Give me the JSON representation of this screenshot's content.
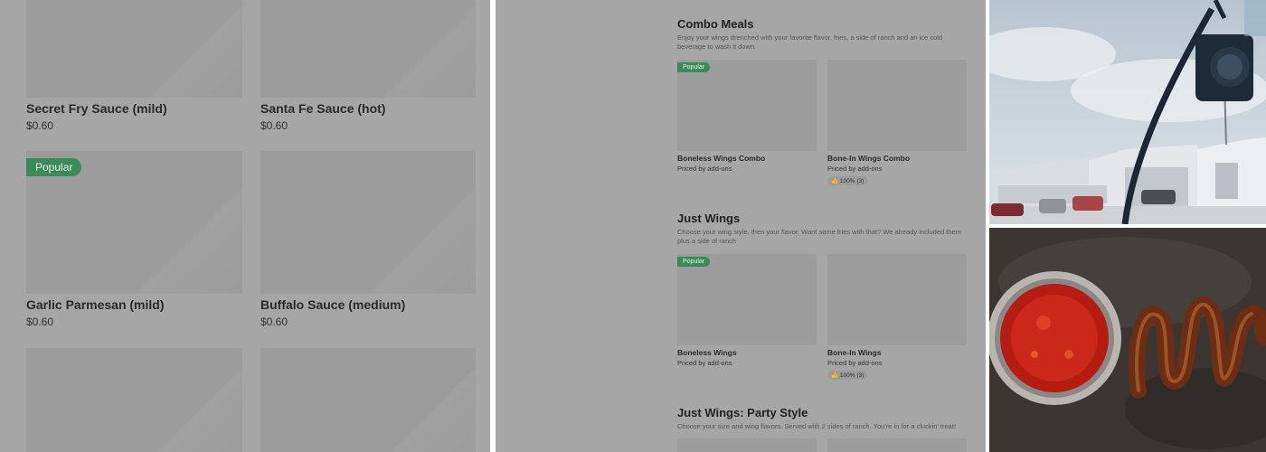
{
  "left_panel": {
    "items": [
      {
        "name": "Secret Fry Sauce (mild)",
        "price": "$0.60"
      },
      {
        "name": "Santa Fe Sauce (hot)",
        "price": "$0.60"
      },
      {
        "name": "Garlic Parmesan (mild)",
        "price": "$0.60",
        "badge": "Popular"
      },
      {
        "name": "Buffalo Sauce (medium)",
        "price": "$0.60"
      }
    ]
  },
  "mid_panel": {
    "sections": [
      {
        "title": "Combo Meals",
        "description": "Enjoy your wings drenched with your favorite flavor, fries, a side of ranch and an ice cold beverage to wash it down.",
        "items": [
          {
            "name": "Boneless Wings Combo",
            "sub": "Priced by add-ons",
            "badge": "Popular"
          },
          {
            "name": "Bone-In Wings Combo",
            "sub": "Priced by add-ons",
            "rating": "👍 100% (3)"
          }
        ]
      },
      {
        "title": "Just Wings",
        "description": "Choose your wing style, then your flavor. Want some fries with that? We already included them plus a side of ranch",
        "items": [
          {
            "name": "Boneless Wings",
            "sub": "Priced by add-ons",
            "badge": "Popular"
          },
          {
            "name": "Bone-In Wings",
            "sub": "Priced by add-ons",
            "rating": "👍 100% (3)"
          }
        ]
      },
      {
        "title": "Just Wings: Party Style",
        "description": "Choose your size and wing flavors. Served with 2 sides of ranch. You're in for a cluckin' treat!"
      }
    ]
  },
  "colors": {
    "overlay_gray": "#a6a6a6",
    "tile_gray": "#9c9c9c",
    "badge_green": "#3a8a5a"
  }
}
